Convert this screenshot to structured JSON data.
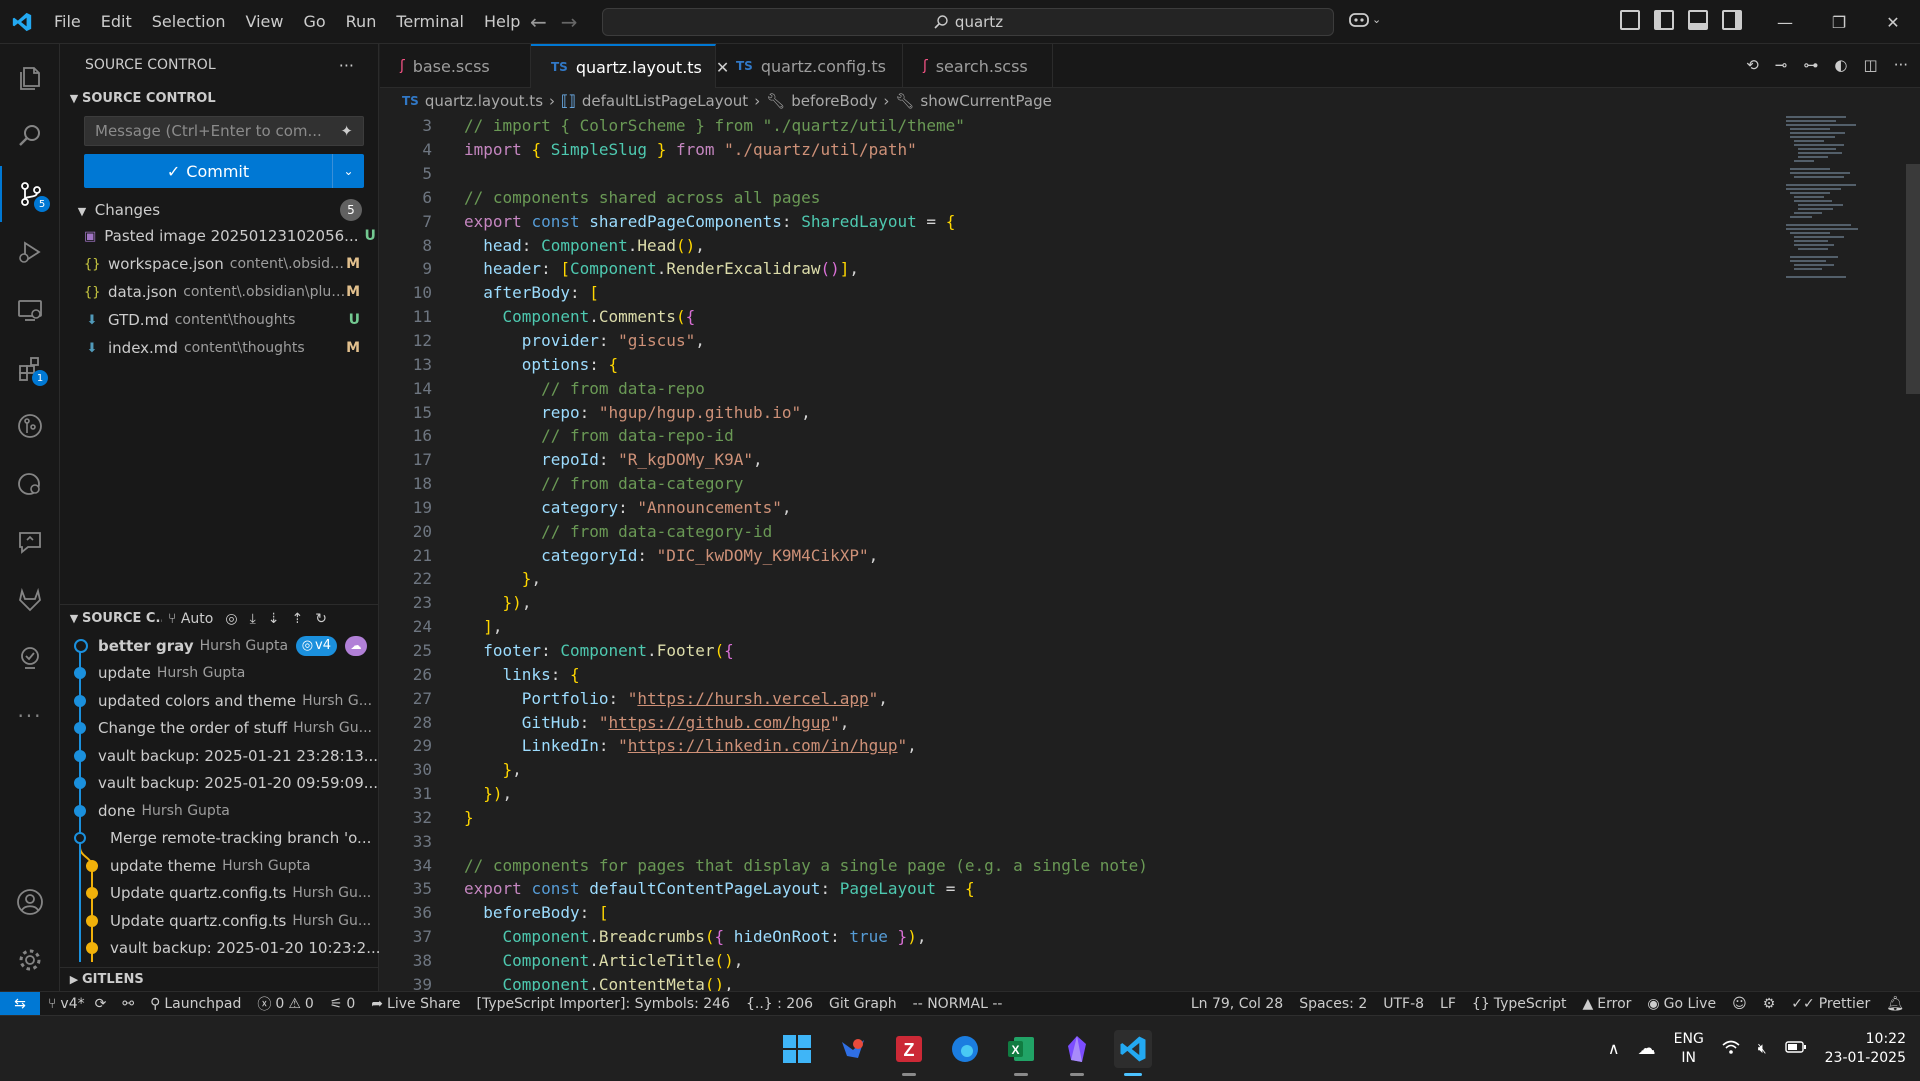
{
  "menu": [
    "File",
    "Edit",
    "Selection",
    "View",
    "Go",
    "Run",
    "Terminal",
    "Help"
  ],
  "command_center": {
    "text": "quartz"
  },
  "sidebar": {
    "header": "SOURCE CONTROL",
    "section_title": "SOURCE CONTROL",
    "message_placeholder": "Message (Ctrl+Enter to com...",
    "commit_label": "Commit",
    "changes_label": "Changes",
    "changes_count": "5",
    "files": [
      {
        "name": "Pasted image 20250123102056...",
        "path": "",
        "status": "U",
        "icon": "image-icon"
      },
      {
        "name": "workspace.json",
        "path": "content\\.obsidian",
        "status": "M",
        "icon": "json-icon"
      },
      {
        "name": "data.json",
        "path": "content\\.obsidian\\plug...",
        "status": "M",
        "icon": "json-icon"
      },
      {
        "name": "GTD.md",
        "path": "content\\thoughts",
        "status": "U",
        "icon": "markdown-icon"
      },
      {
        "name": "index.md",
        "path": "content\\thoughts",
        "status": "M",
        "icon": "markdown-icon"
      }
    ],
    "graph_title": "SOURCE C...",
    "graph_auto": "Auto",
    "commits": [
      {
        "msg": "better gray",
        "author": "Hursh Gupta",
        "tag": "v4"
      },
      {
        "msg": "update",
        "author": "Hursh Gupta"
      },
      {
        "msg": "updated colors and theme",
        "author": "Hursh G..."
      },
      {
        "msg": "Change the order of stuff",
        "author": "Hursh Gu..."
      },
      {
        "msg": "vault backup: 2025-01-21 23:28:13...",
        "author": ""
      },
      {
        "msg": "vault backup: 2025-01-20 09:59:09...",
        "author": ""
      },
      {
        "msg": "done",
        "author": "Hursh Gupta"
      },
      {
        "msg": "Merge remote-tracking branch 'o...",
        "author": ""
      },
      {
        "msg": "update theme",
        "author": "Hursh Gupta"
      },
      {
        "msg": "Update quartz.config.ts",
        "author": "Hursh Gu..."
      },
      {
        "msg": "Update quartz.config.ts",
        "author": "Hursh Gu..."
      },
      {
        "msg": "vault backup: 2025-01-20 10:23:2...",
        "author": ""
      }
    ],
    "gitlens": "GITLENS"
  },
  "activity_badges": {
    "scm": "5",
    "extensions": "1"
  },
  "tabs": [
    {
      "label": "base.scss",
      "type": "scss"
    },
    {
      "label": "quartz.layout.ts",
      "type": "ts",
      "active": true
    },
    {
      "label": "quartz.config.ts",
      "type": "ts"
    },
    {
      "label": "search.scss",
      "type": "scss"
    }
  ],
  "breadcrumbs": [
    "quartz.layout.ts",
    "defaultListPageLayout",
    "beforeBody",
    "showCurrentPage"
  ],
  "code_lines": [
    {
      "n": "3",
      "t": "// import { ColorScheme } from \"./quartz/util/theme\""
    },
    {
      "n": "4",
      "t": "import { SimpleSlug } from \"./quartz/util/path\""
    },
    {
      "n": "5",
      "t": ""
    },
    {
      "n": "6",
      "t": "// components shared across all pages"
    },
    {
      "n": "7",
      "t": "export const sharedPageComponents: SharedLayout = {"
    },
    {
      "n": "8",
      "t": "  head: Component.Head(),"
    },
    {
      "n": "9",
      "t": "  header: [Component.RenderExcalidraw()],"
    },
    {
      "n": "10",
      "t": "  afterBody: ["
    },
    {
      "n": "11",
      "t": "    Component.Comments({"
    },
    {
      "n": "12",
      "t": "      provider: \"giscus\","
    },
    {
      "n": "13",
      "t": "      options: {"
    },
    {
      "n": "14",
      "t": "        // from data-repo"
    },
    {
      "n": "15",
      "t": "        repo: \"hgup/hgup.github.io\","
    },
    {
      "n": "16",
      "t": "        // from data-repo-id"
    },
    {
      "n": "17",
      "t": "        repoId: \"R_kgDOMy_K9A\","
    },
    {
      "n": "18",
      "t": "        // from data-category"
    },
    {
      "n": "19",
      "t": "        category: \"Announcements\","
    },
    {
      "n": "20",
      "t": "        // from data-category-id"
    },
    {
      "n": "21",
      "t": "        categoryId: \"DIC_kwDOMy_K9M4CikXP\","
    },
    {
      "n": "22",
      "t": "      },"
    },
    {
      "n": "23",
      "t": "    }),"
    },
    {
      "n": "24",
      "t": "  ],"
    },
    {
      "n": "25",
      "t": "  footer: Component.Footer({"
    },
    {
      "n": "26",
      "t": "    links: {"
    },
    {
      "n": "27",
      "t": "      Portfolio: \"https://hursh.vercel.app\","
    },
    {
      "n": "28",
      "t": "      GitHub: \"https://github.com/hgup\","
    },
    {
      "n": "29",
      "t": "      LinkedIn: \"https://linkedin.com/in/hgup\","
    },
    {
      "n": "30",
      "t": "    },"
    },
    {
      "n": "31",
      "t": "  }),"
    },
    {
      "n": "32",
      "t": "}"
    },
    {
      "n": "33",
      "t": ""
    },
    {
      "n": "34",
      "t": "// components for pages that display a single page (e.g. a single note)"
    },
    {
      "n": "35",
      "t": "export const defaultContentPageLayout: PageLayout = {"
    },
    {
      "n": "36",
      "t": "  beforeBody: ["
    },
    {
      "n": "37",
      "t": "    Component.Breadcrumbs({ hideOnRoot: true }),"
    },
    {
      "n": "38",
      "t": "    Component.ArticleTitle(),"
    },
    {
      "n": "39",
      "t": "    Component.ContentMeta(),"
    }
  ],
  "status": {
    "branch": "v4*",
    "launchpad": "Launchpad",
    "problems": "0",
    "warnings": "0",
    "ports": "0",
    "liveshare": "Live Share",
    "ts_importer": "[TypeScript Importer]: Symbols: 246",
    "braces": "{..} : 206",
    "gitgraph": "Git Graph",
    "vim": "-- NORMAL --",
    "position": "Ln 79, Col 28",
    "spaces": "Spaces: 2",
    "encoding": "UTF-8",
    "eol": "LF",
    "language": "TypeScript",
    "error": "Error",
    "golive": "Go Live",
    "prettier": "Prettier"
  },
  "taskbar": {
    "lang_top": "ENG",
    "lang_bottom": "IN",
    "time": "10:22",
    "date": "23-01-2025"
  }
}
